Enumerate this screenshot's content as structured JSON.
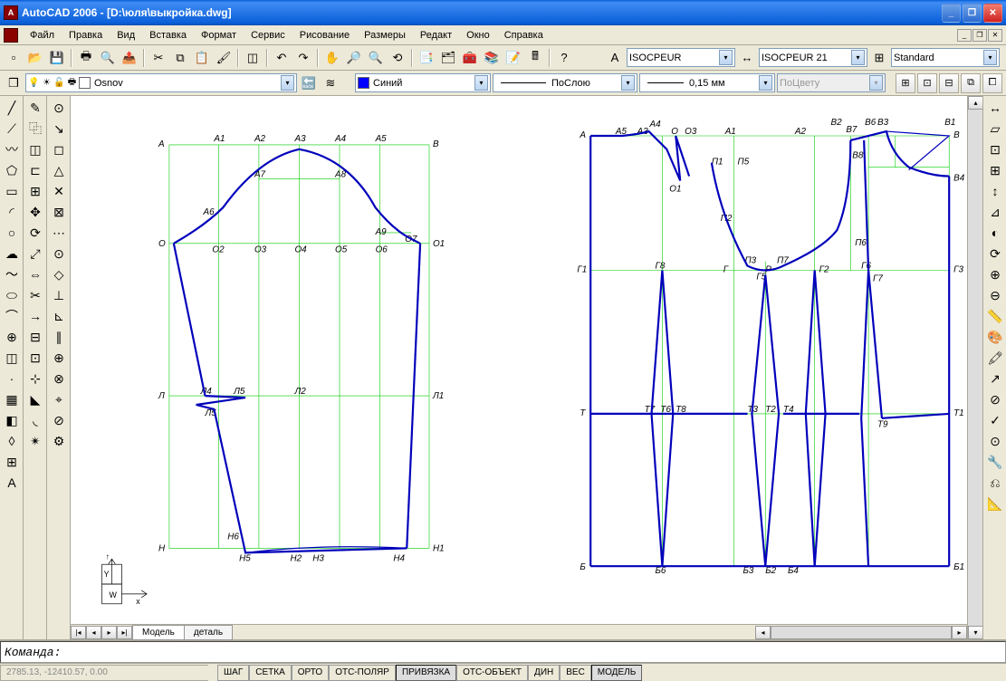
{
  "titlebar": {
    "text": "AutoCAD 2006 - [D:\\юля\\выкройка.dwg]"
  },
  "menu": [
    "Файл",
    "Правка",
    "Вид",
    "Вставка",
    "Формат",
    "Сервис",
    "Рисование",
    "Размеры",
    "Редакт",
    "Окно",
    "Справка"
  ],
  "row2": {
    "layer_name": "Osnov",
    "color_name": "Синий",
    "linetype": "ПоСлою",
    "lineweight": "0,15 мм",
    "plotstyle": "ПоЦвету"
  },
  "row1": {
    "textstyle": "ISOCPEUR",
    "dimstyle": "ISOCPEUR 21",
    "tablestyle": "Standard"
  },
  "tabs": {
    "model": "Модель",
    "detail": "деталь"
  },
  "command": {
    "prompt": "Команда:"
  },
  "status": {
    "coords": "2785.13, -12410.57, 0.00",
    "toggles": [
      "ШАГ",
      "СЕТКА",
      "ОРТО",
      "ОТС-ПОЛЯР",
      "ПРИВЯЗКА",
      "ОТС-ОБЪЕКТ",
      "ДИН",
      "ВЕС",
      "МОДЕЛЬ"
    ]
  },
  "leftLabels": {
    "top": [
      "А",
      "А1",
      "А2",
      "А3",
      "А4",
      "А5",
      "В"
    ],
    "midtop": [
      "А7",
      "А8"
    ],
    "a6": "А6",
    "a9": "А9",
    "o": [
      "О",
      "О2",
      "О3",
      "О4",
      "О5",
      "О6",
      "О7",
      "О1"
    ],
    "l": [
      "Л",
      "Л4",
      "Л5",
      "Л2",
      "Л1"
    ],
    "l5b": "Л5",
    "h": [
      "Н",
      "Н5",
      "Н6",
      "Н2",
      "Н3",
      "Н4",
      "Н1"
    ]
  },
  "rightLabels": {
    "top": [
      "А",
      "А5",
      "А3",
      "А4",
      "О",
      "О3",
      "А1",
      "А2",
      "В2",
      "В7",
      "В6",
      "В3",
      "В1",
      "В"
    ],
    "o1": "О1",
    "p1": "П1",
    "p5": "П5",
    "b8": "В8",
    "b4": "В4",
    "p2": "П2",
    "p3": "П3",
    "p": "Р",
    "p7": "П7",
    "p6": "П6",
    "g": [
      "Г1",
      "Г8",
      "Г",
      "Г5",
      "Г2",
      "Г6",
      "Г7",
      "Г3"
    ],
    "t": [
      "Т",
      "Т7",
      "Т6",
      "Т8",
      "Т3",
      "Т2",
      "Т4",
      "Т9",
      "Т1"
    ],
    "b": [
      "Б",
      "Б6",
      "Б3",
      "Б2",
      "Б4",
      "Б1"
    ]
  }
}
